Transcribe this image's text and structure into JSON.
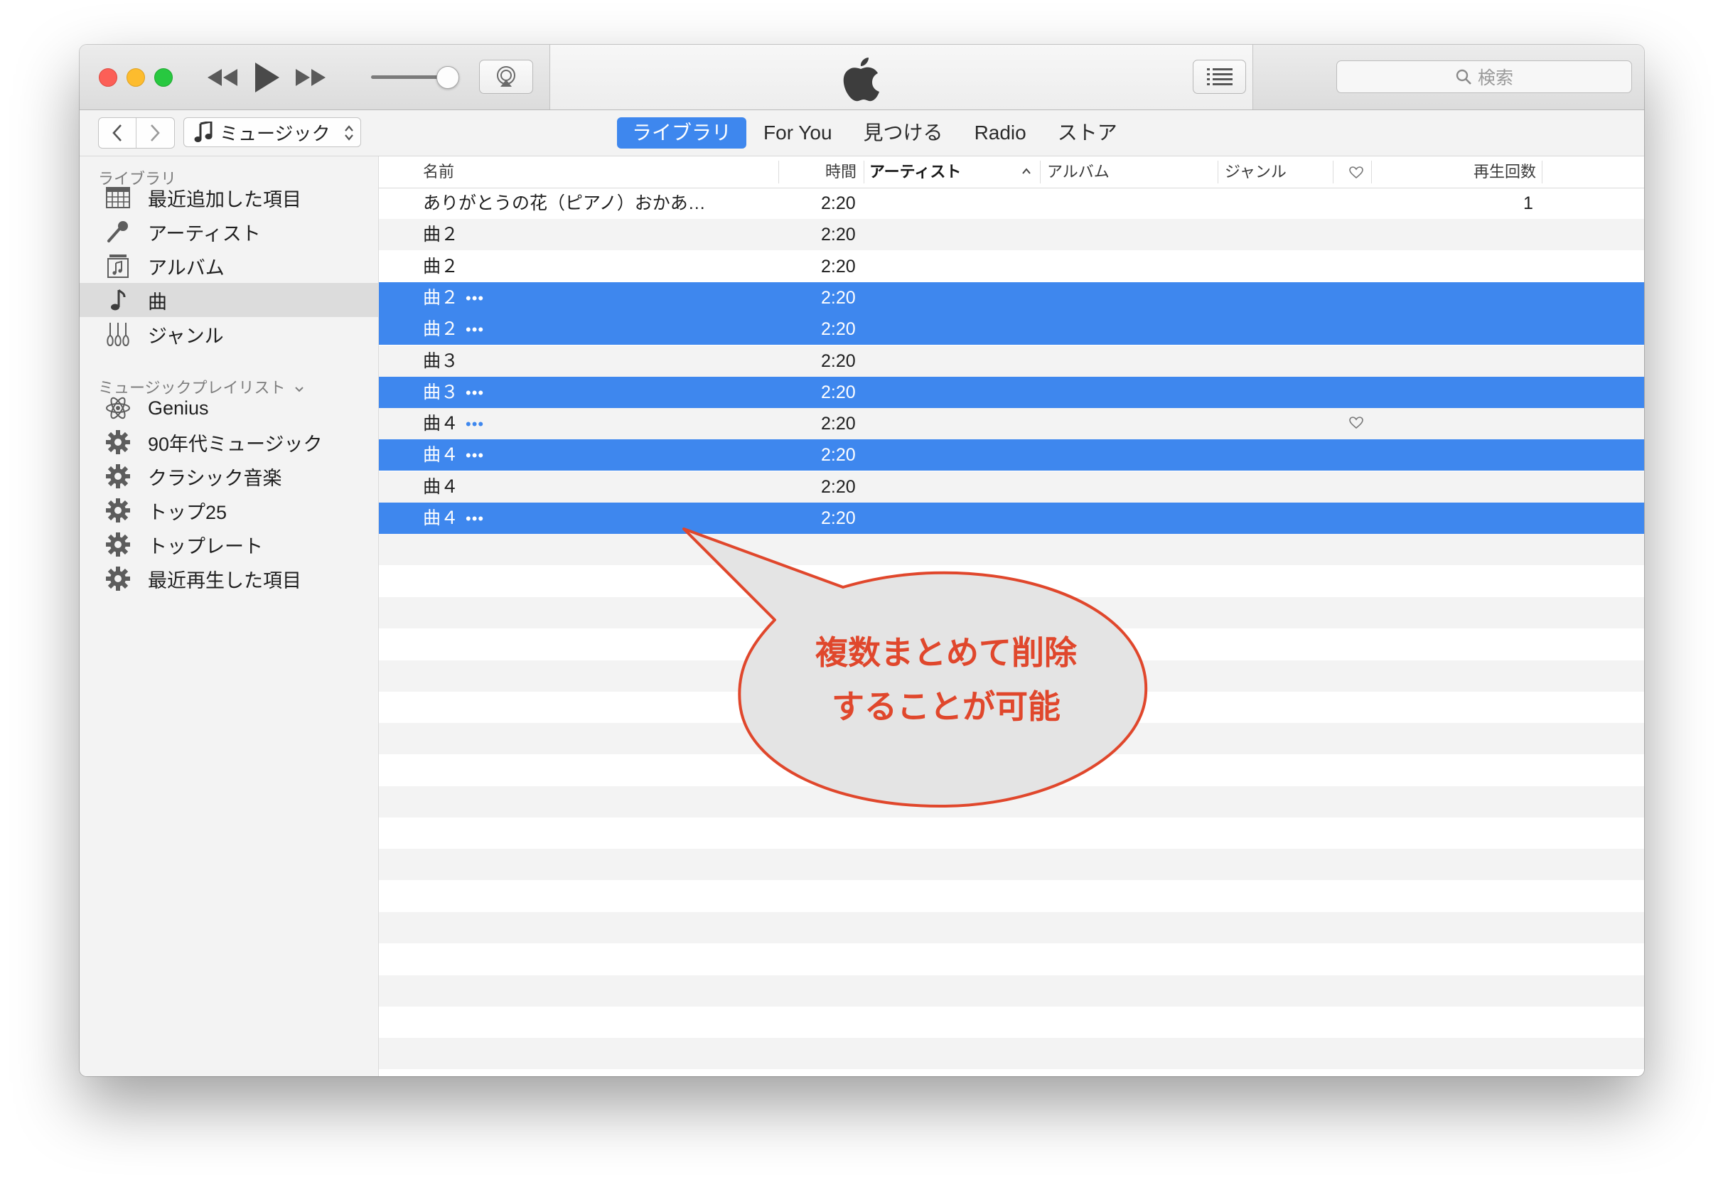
{
  "toolbar": {
    "search_placeholder": "検索"
  },
  "nav": {
    "media_selector": "ミュージック",
    "tabs": [
      {
        "label": "ライブラリ",
        "active": true
      },
      {
        "label": "For You",
        "active": false
      },
      {
        "label": "見つける",
        "active": false
      },
      {
        "label": "Radio",
        "active": false
      },
      {
        "label": "ストア",
        "active": false
      }
    ]
  },
  "sidebar": {
    "library_header": "ライブラリ",
    "library_items": [
      {
        "label": "最近追加した項目",
        "icon": "grid-calendar-icon"
      },
      {
        "label": "アーティスト",
        "icon": "microphone-icon"
      },
      {
        "label": "アルバム",
        "icon": "album-icon"
      },
      {
        "label": "曲",
        "icon": "music-note-icon",
        "selected": true
      },
      {
        "label": "ジャンル",
        "icon": "guitars-icon"
      }
    ],
    "playlist_header": "ミュージックプレイリスト",
    "playlists": [
      {
        "label": "Genius",
        "icon": "genius-atom-icon"
      },
      {
        "label": "90年代ミュージック",
        "icon": "smart-playlist-gear-icon"
      },
      {
        "label": "クラシック音楽",
        "icon": "smart-playlist-gear-icon"
      },
      {
        "label": "トップ25",
        "icon": "smart-playlist-gear-icon"
      },
      {
        "label": "トップレート",
        "icon": "smart-playlist-gear-icon"
      },
      {
        "label": "最近再生した項目",
        "icon": "smart-playlist-gear-icon"
      }
    ]
  },
  "table": {
    "columns": {
      "name": "名前",
      "time": "時間",
      "artist": "アーティスト",
      "album": "アルバム",
      "genre": "ジャンル",
      "plays": "再生回数"
    },
    "sort_indicator": "^",
    "rows": [
      {
        "name": "ありがとうの花（ピアノ）おかあ…",
        "time": "2:20",
        "plays": "1",
        "selected": false,
        "dots": false,
        "heart": false
      },
      {
        "name": "曲２",
        "time": "2:20",
        "plays": "",
        "selected": false,
        "dots": false,
        "heart": false
      },
      {
        "name": "曲２",
        "time": "2:20",
        "plays": "",
        "selected": false,
        "dots": false,
        "heart": false
      },
      {
        "name": "曲２",
        "time": "2:20",
        "plays": "",
        "selected": true,
        "dots": true,
        "heart": false
      },
      {
        "name": "曲２",
        "time": "2:20",
        "plays": "",
        "selected": true,
        "dots": true,
        "heart": false
      },
      {
        "name": "曲３",
        "time": "2:20",
        "plays": "",
        "selected": false,
        "dots": false,
        "heart": false
      },
      {
        "name": "曲３",
        "time": "2:20",
        "plays": "",
        "selected": true,
        "dots": true,
        "heart": false
      },
      {
        "name": "曲４",
        "time": "2:20",
        "plays": "",
        "selected": false,
        "dots": true,
        "heart": true
      },
      {
        "name": "曲４",
        "time": "2:20",
        "plays": "",
        "selected": true,
        "dots": true,
        "heart": false
      },
      {
        "name": "曲４",
        "time": "2:20",
        "plays": "",
        "selected": false,
        "dots": false,
        "heart": false
      },
      {
        "name": "曲４",
        "time": "2:20",
        "plays": "",
        "selected": true,
        "dots": true,
        "heart": false
      }
    ]
  },
  "callout": {
    "line1": "複数まとめて削除",
    "line2": "することが可能"
  },
  "colors": {
    "selection": "#3e87ee",
    "callout_stroke": "#e0472c",
    "callout_fill": "#e4e4e4"
  }
}
